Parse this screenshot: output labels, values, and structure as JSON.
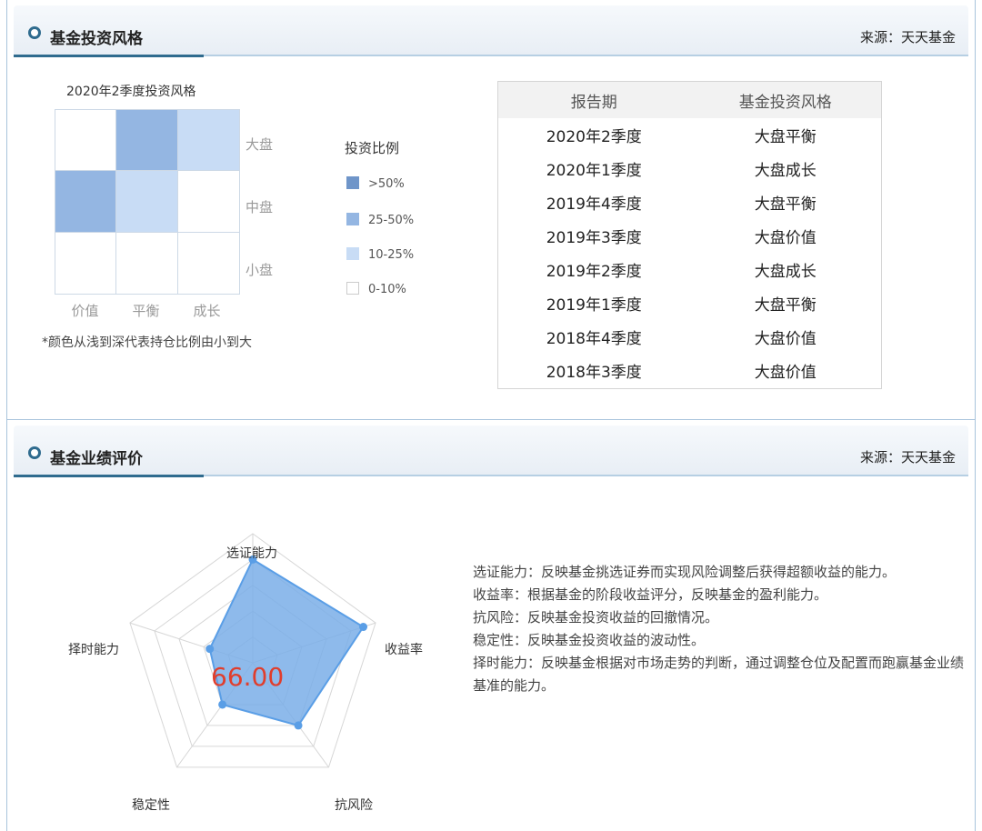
{
  "style_panel": {
    "title": "基金投资风格",
    "source": "来源：天天基金",
    "stylebox": {
      "title": "2020年2季度投资风格",
      "rows": [
        "大盘",
        "中盘",
        "小盘"
      ],
      "cols": [
        "价值",
        "平衡",
        "成长"
      ],
      "cell_levels": [
        [
          0,
          2,
          1
        ],
        [
          2,
          1,
          0
        ],
        [
          0,
          0,
          0
        ]
      ],
      "note": "*颜色从浅到深代表持仓比例由小到大"
    },
    "legend": {
      "title": "投资比例",
      "items": [
        {
          "label": ">50%",
          "color": "#6f95c9"
        },
        {
          "label": "25-50%",
          "color": "#94b6e2"
        },
        {
          "label": "10-25%",
          "color": "#c8dcf5"
        },
        {
          "label": "0-10%",
          "color": "#ffffff"
        }
      ]
    },
    "table": {
      "headers": [
        "报告期",
        "基金投资风格"
      ],
      "rows": [
        [
          "2020年2季度",
          "大盘平衡"
        ],
        [
          "2020年1季度",
          "大盘成长"
        ],
        [
          "2019年4季度",
          "大盘平衡"
        ],
        [
          "2019年3季度",
          "大盘价值"
        ],
        [
          "2019年2季度",
          "大盘成长"
        ],
        [
          "2019年1季度",
          "大盘平衡"
        ],
        [
          "2018年4季度",
          "大盘价值"
        ],
        [
          "2018年3季度",
          "大盘价值"
        ]
      ]
    }
  },
  "perf_panel": {
    "title": "基金业绩评价",
    "source": "来源：天天基金",
    "chart_data": {
      "type": "radar",
      "axes": [
        "选证能力",
        "收益率",
        "抗风险",
        "稳定性",
        "择时能力"
      ],
      "values": [
        80,
        90,
        60,
        40,
        35
      ],
      "max": 100,
      "score": "66.00",
      "fill_color": "#7aaee8",
      "line_color": "#5a9ee6",
      "score_color": "#e03e2d"
    },
    "descriptions": [
      "选证能力：反映基金挑选证券而实现风险调整后获得超额收益的能力。",
      "收益率：根据基金的阶段收益评分，反映基金的盈利能力。",
      "抗风险：反映基金投资收益的回撤情况。",
      "稳定性：反映基金投资收益的波动性。",
      "择时能力：反映基金根据对市场走势的判断，通过调整仓位及配置而跑赢基金业绩基准的能力。"
    ]
  }
}
